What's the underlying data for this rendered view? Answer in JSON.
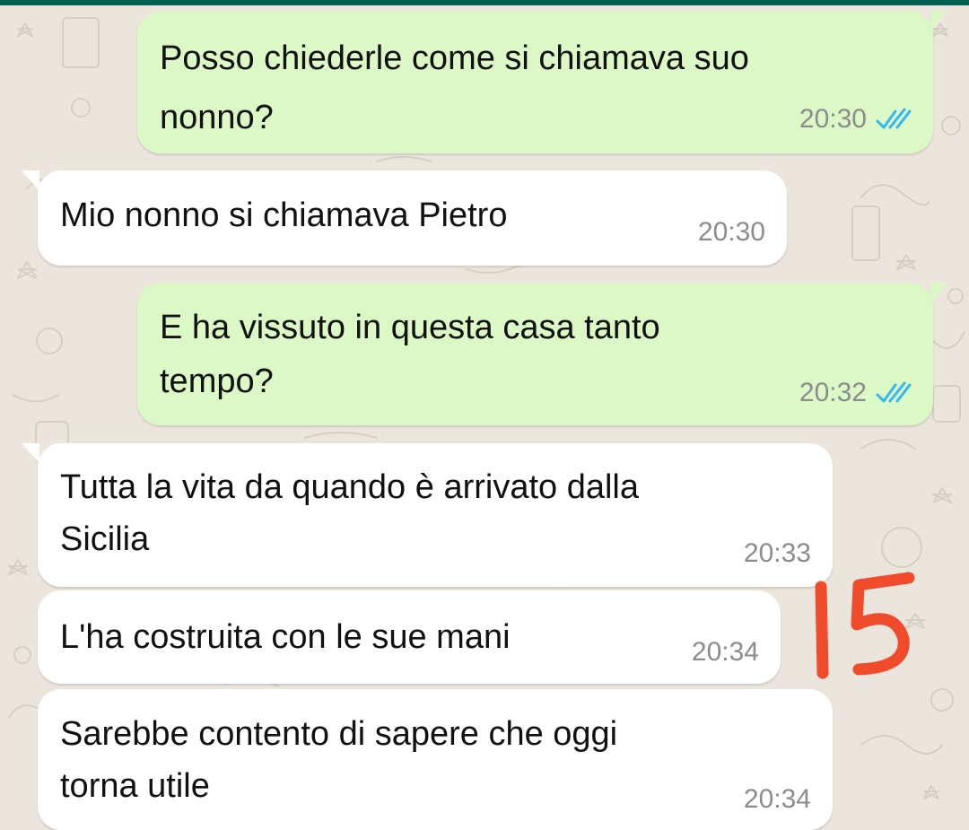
{
  "chat": {
    "messages": [
      {
        "direction": "outgoing",
        "lines": [
          "Posso chiederle come si chiamava suo",
          "nonno?"
        ],
        "time": "20:30",
        "status_icon": "double-check-read-icon",
        "status_color": "#34B7F1"
      },
      {
        "direction": "incoming",
        "lines": [
          "Mio nonno si chiamava Pietro"
        ],
        "time": "20:30"
      },
      {
        "direction": "outgoing",
        "lines": [
          "E ha vissuto in questa casa tanto",
          "tempo?"
        ],
        "time": "20:32",
        "status_icon": "double-check-read-icon",
        "status_color": "#34B7F1"
      },
      {
        "direction": "incoming",
        "lines": [
          "Tutta la vita da quando è arrivato dalla",
          "Sicilia"
        ],
        "time": "20:33"
      },
      {
        "direction": "incoming",
        "lines": [
          "L'ha costruita con le sue mani"
        ],
        "time": "20:34"
      },
      {
        "direction": "incoming",
        "lines": [
          "Sarebbe contento di sapere che oggi",
          "torna utile"
        ],
        "time": "20:34"
      }
    ]
  },
  "annotation": {
    "text": "15",
    "color": "#F04B2A"
  },
  "colors": {
    "outgoing_bubble": "#DCF8C6",
    "incoming_bubble": "#FFFFFF",
    "background": "#ECE5DD",
    "header": "#075E54"
  }
}
